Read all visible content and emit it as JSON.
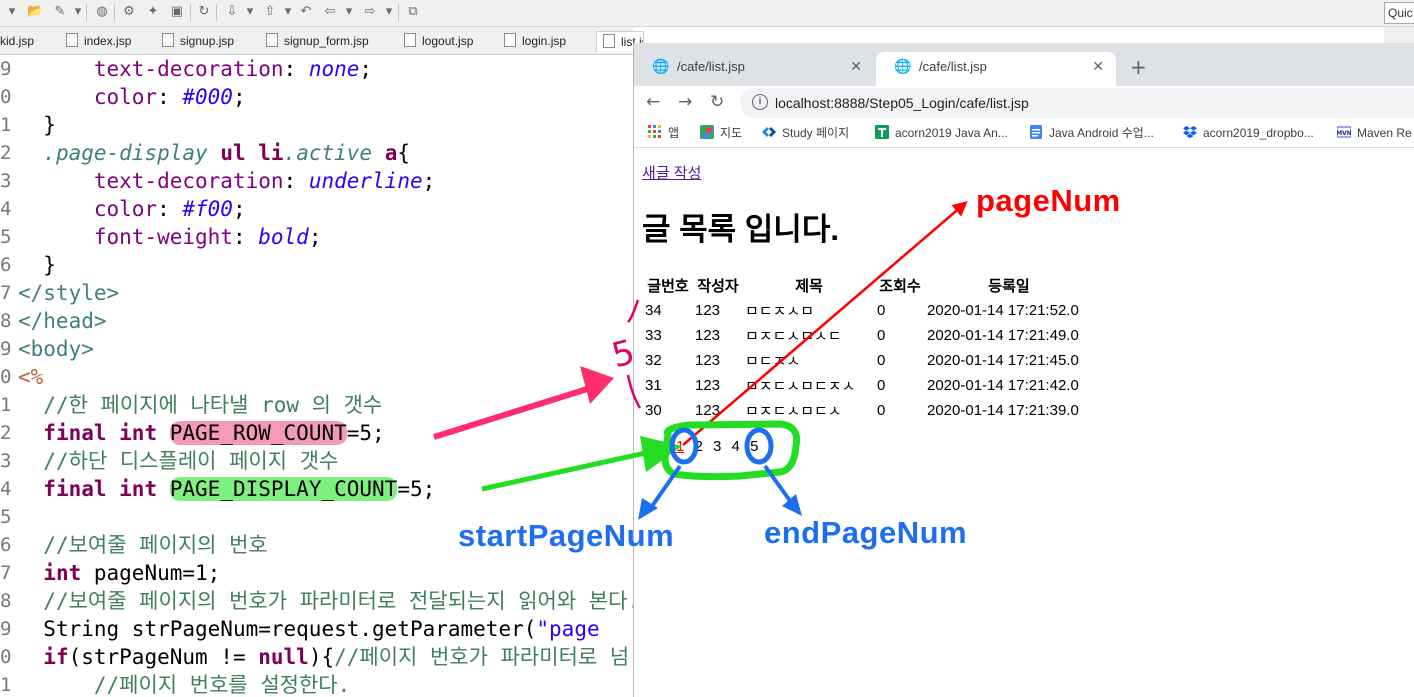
{
  "ide": {
    "quick_access": "Quic",
    "tabs": [
      "kid.jsp",
      "index.jsp",
      "signup.jsp",
      "signup_form.jsp",
      "logout.jsp",
      "login.jsp",
      "list.jsp"
    ],
    "line_numbers": [
      "9",
      "0",
      "1",
      "2",
      "3",
      "4",
      "5",
      "6",
      "7",
      "8",
      "9",
      "0",
      "1",
      "2",
      "3",
      "4",
      "5",
      "6",
      "7",
      "8",
      "9",
      "0",
      "1"
    ],
    "code": {
      "l1_prop": "text-decoration",
      "l1_val": "none",
      "l2_prop": "color",
      "l2_val": "#000",
      "l3": "}",
      "l4_sel": ".page-display",
      "l4_ul": "ul",
      "l4_li": "li",
      "l4_active": ".active",
      "l4_a": "a",
      "l5_prop": "text-decoration",
      "l5_val": "underline",
      "l6_prop": "color",
      "l6_val": "#f00",
      "l7_prop": "font-weight",
      "l7_val": "bold",
      "l8": "}",
      "l9": "</style>",
      "l10": "</head>",
      "l11": "<body>",
      "l12": "<%",
      "l13": "//한 페이지에 나타낼 row 의 갯수",
      "l14_kw": "final int",
      "l14_var": "PAGE_ROW_COUNT",
      "l14_rest": "=5;",
      "l15": "//하단 디스플레이 페이지 갯수",
      "l16_kw": "final int",
      "l16_var": "PAGE_DISPLAY_COUNT",
      "l16_rest": "=5;",
      "l18": "//보여줄 페이지의 번호",
      "l19_kw": "int",
      "l19_rest": " pageNum=1;",
      "l20": "//보여줄 페이지의 번호가 파라미터로 전달되는지 읽어와 본다.",
      "l21_a": "String strPageNum=request.getParameter(",
      "l21_str": "\"page",
      "l22_kw": "if",
      "l22_a": "(strPageNum != ",
      "l22_null": "null",
      "l22_b": "){",
      "l22_cmt": "//페이지 번호가 파라미터로 넘",
      "l23": "//페이지 번호를 설정한다."
    }
  },
  "browser": {
    "tabs": [
      "/cafe/list.jsp",
      "/cafe/list.jsp"
    ],
    "url": "localhost:8888/Step05_Login/cafe/list.jsp",
    "bookmarks": [
      "앱",
      "지도",
      "Study 페이지",
      "acorn2019 Java An...",
      "Java Android 수업...",
      "acorn2019_dropbo...",
      "Maven Re"
    ]
  },
  "page": {
    "new_post_link": "새글 작성",
    "title": "글 목록 입니다.",
    "columns": [
      "글번호",
      "작성자",
      "제목",
      "조회수",
      "등록일"
    ],
    "rows": [
      [
        "34",
        "123",
        "ㅁㄷㅈㅅㅁ",
        "0",
        "2020-01-14 17:21:52.0"
      ],
      [
        "33",
        "123",
        "ㅁㅈㄷㅅㅁㅅㄷ",
        "0",
        "2020-01-14 17:21:49.0"
      ],
      [
        "32",
        "123",
        "ㅁㄷㅈㅅ",
        "0",
        "2020-01-14 17:21:45.0"
      ],
      [
        "31",
        "123",
        "ㅁㅈㄷㅅㅁㄷㅈㅅ",
        "0",
        "2020-01-14 17:21:42.0"
      ],
      [
        "30",
        "123",
        "ㅁㅈㄷㅅㅁㄷㅅ",
        "0",
        "2020-01-14 17:21:39.0"
      ]
    ],
    "pages": [
      "1",
      "2",
      "3",
      "4",
      "5"
    ],
    "active_page": "1"
  },
  "annotations": {
    "page_num": "pageNum",
    "start_page_num": "startPageNum",
    "end_page_num": "endPageNum",
    "handwritten_five": "5",
    "colors": {
      "red": "#ff0000",
      "pink": "#ff2d6e",
      "green": "#22dd22",
      "blue": "#1e6ff0"
    }
  }
}
